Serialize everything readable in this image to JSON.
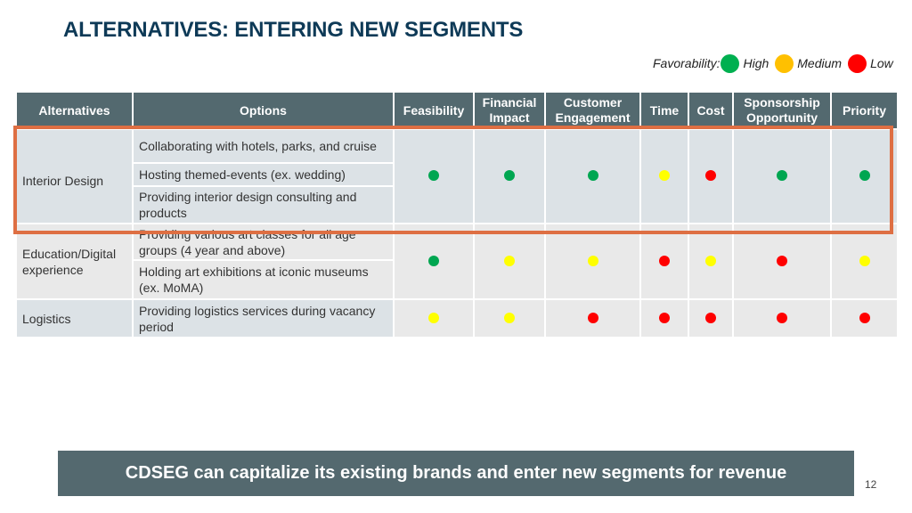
{
  "title": "ALTERNATIVES: ENTERING NEW SEGMENTS",
  "legend": {
    "label": "Favorability:",
    "items": [
      {
        "label": "High",
        "color": "#00b050"
      },
      {
        "label": "Medium",
        "color": "#ffc000"
      },
      {
        "label": "Low",
        "color": "#ff0000"
      }
    ]
  },
  "rating_colors": {
    "high": "#00a651",
    "medium": "#ffff00",
    "low": "#ff0000"
  },
  "table": {
    "headers": [
      "Alternatives",
      "Options",
      "Feasibility",
      "Financial Impact",
      "Customer Engagement",
      "Time",
      "Cost",
      "Sponsorship Opportunity",
      "Priority"
    ],
    "groups": [
      {
        "alternative": "Interior Design",
        "options": [
          "Collaborating with hotels, parks, and cruise",
          "Hosting themed-events (ex. wedding)",
          "Providing interior design consulting and products"
        ],
        "ratings": [
          "high",
          "high",
          "high",
          "medium",
          "low",
          "high",
          "high"
        ],
        "highlighted": true
      },
      {
        "alternative": "Education/Digital experience",
        "options": [
          "Providing various art classes for all age groups (4 year and above)",
          "Holding art exhibitions at iconic museums (ex. MoMA)"
        ],
        "ratings": [
          "high",
          "medium",
          "medium",
          "low",
          "medium",
          "low",
          "medium"
        ],
        "highlighted": false
      },
      {
        "alternative": "Logistics",
        "options": [
          "Providing logistics services during vacancy period"
        ],
        "ratings": [
          "medium",
          "medium",
          "low",
          "low",
          "low",
          "low",
          "low"
        ],
        "highlighted": false
      }
    ]
  },
  "banner": "CDSEG can capitalize its existing brands and enter new segments for revenue",
  "page_number": "12"
}
